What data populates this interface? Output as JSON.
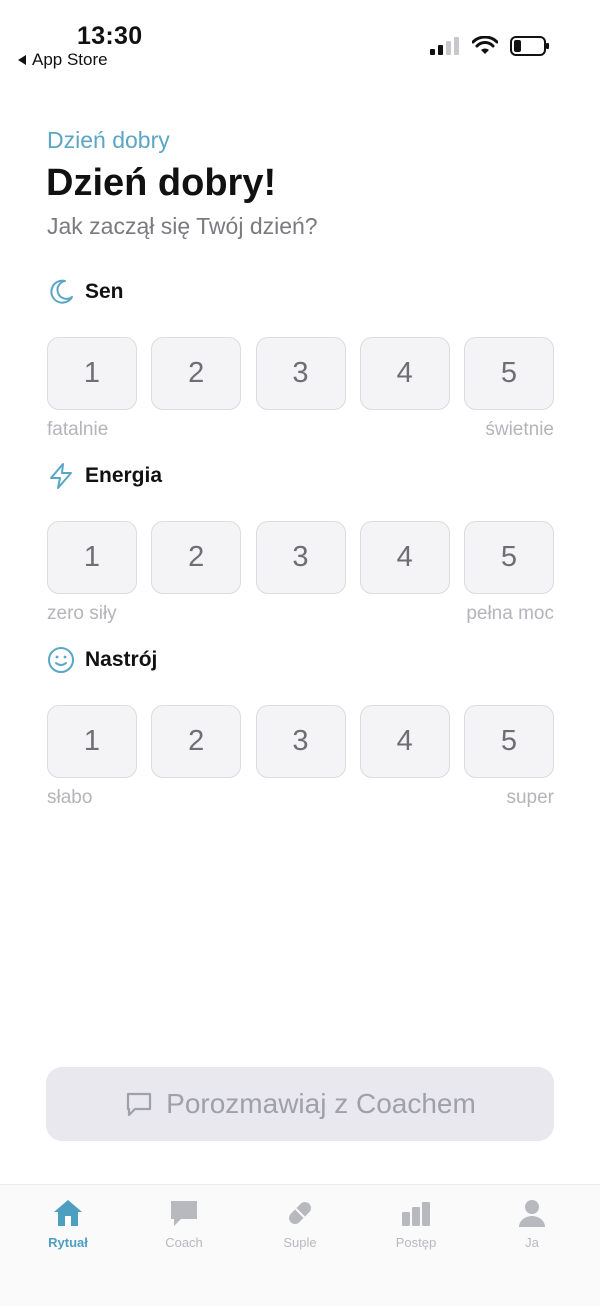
{
  "status_bar": {
    "time": "13:30",
    "back_label": "App Store"
  },
  "header": {
    "eyebrow": "Dzień dobry",
    "title": "Dzień dobry!",
    "subtitle": "Jak zaczął się Twój dzień?"
  },
  "sections": [
    {
      "label": "Sen",
      "icon": "moon-icon",
      "options": [
        "1",
        "2",
        "3",
        "4",
        "5"
      ],
      "low_label": "fatalnie",
      "high_label": "świetnie"
    },
    {
      "label": "Energia",
      "icon": "lightning-icon",
      "options": [
        "1",
        "2",
        "3",
        "4",
        "5"
      ],
      "low_label": "zero siły",
      "high_label": "pełna moc"
    },
    {
      "label": "Nastrój",
      "icon": "smiley-icon",
      "options": [
        "1",
        "2",
        "3",
        "4",
        "5"
      ],
      "low_label": "słabo",
      "high_label": "super"
    }
  ],
  "coach_button": {
    "label": "Porozmawiaj z Coachem",
    "icon": "chat-bubble-icon"
  },
  "tabbar": {
    "items": [
      {
        "label": "Rytuał",
        "icon": "home-icon",
        "active": true
      },
      {
        "label": "Coach",
        "icon": "chat-icon",
        "active": false
      },
      {
        "label": "Suple",
        "icon": "pill-icon",
        "active": false
      },
      {
        "label": "Postęp",
        "icon": "bar-chart-icon",
        "active": false
      },
      {
        "label": "Ja",
        "icon": "person-icon",
        "active": false
      }
    ]
  },
  "colors": {
    "accent": "#5aa6c4",
    "muted": "#b4b4ba",
    "button_bg": "#f4f4f6"
  }
}
